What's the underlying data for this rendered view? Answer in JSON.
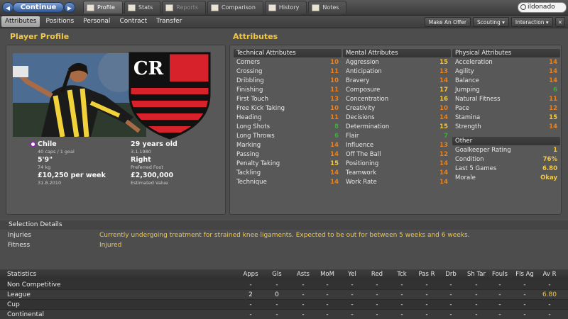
{
  "topbar": {
    "back_glyph": "◀",
    "forward_glyph": "▶",
    "continue_label": "Continue",
    "tabs": [
      {
        "label": "Profile",
        "state": "active"
      },
      {
        "label": "Stats",
        "state": "normal"
      },
      {
        "label": "Reports",
        "state": "dim"
      },
      {
        "label": "Comparison",
        "state": "normal"
      },
      {
        "label": "History",
        "state": "normal"
      },
      {
        "label": "Notes",
        "state": "normal"
      }
    ],
    "search_value": "ildonado"
  },
  "subbar": {
    "tabs": [
      "Attributes",
      "Positions",
      "Personal",
      "Contract",
      "Transfer"
    ],
    "actions": [
      "Make An Offer",
      "Scouting ▾",
      "Interaction ▾"
    ],
    "close_glyph": "✕"
  },
  "player_profile": {
    "title": "Player Profile",
    "nation": "Chile",
    "caps": "40 caps / 1 goal",
    "age": "29 years old",
    "dob": "3.1.1980",
    "height": "5'9\"",
    "weight": "74 kg",
    "foot": "Right",
    "foot_label": "Preferred Foot",
    "wage": "£10,250 per week",
    "contract_end": "31.8.2010",
    "value": "£2,300,000",
    "value_label": "Estimated Value"
  },
  "attributes": {
    "title": "Attributes",
    "technical": {
      "title": "Technical Attributes",
      "items": [
        {
          "name": "Corners",
          "value": 10
        },
        {
          "name": "Crossing",
          "value": 11
        },
        {
          "name": "Dribbling",
          "value": 10
        },
        {
          "name": "Finishing",
          "value": 11
        },
        {
          "name": "First Touch",
          "value": 13
        },
        {
          "name": "Free Kick Taking",
          "value": 10
        },
        {
          "name": "Heading",
          "value": 11
        },
        {
          "name": "Long Shots",
          "value": 8
        },
        {
          "name": "Long Throws",
          "value": 6
        },
        {
          "name": "Marking",
          "value": 14
        },
        {
          "name": "Passing",
          "value": 14
        },
        {
          "name": "Penalty Taking",
          "value": 15
        },
        {
          "name": "Tackling",
          "value": 14
        },
        {
          "name": "Technique",
          "value": 14
        }
      ]
    },
    "mental": {
      "title": "Mental Attributes",
      "items": [
        {
          "name": "Aggression",
          "value": 15
        },
        {
          "name": "Anticipation",
          "value": 13
        },
        {
          "name": "Bravery",
          "value": 14
        },
        {
          "name": "Composure",
          "value": 17
        },
        {
          "name": "Concentration",
          "value": 16
        },
        {
          "name": "Creativity",
          "value": 10
        },
        {
          "name": "Decisions",
          "value": 14
        },
        {
          "name": "Determination",
          "value": 15
        },
        {
          "name": "Flair",
          "value": 7
        },
        {
          "name": "Influence",
          "value": 13
        },
        {
          "name": "Off The Ball",
          "value": 12
        },
        {
          "name": "Positioning",
          "value": 14
        },
        {
          "name": "Teamwork",
          "value": 14
        },
        {
          "name": "Work Rate",
          "value": 14
        }
      ]
    },
    "physical": {
      "title": "Physical Attributes",
      "items": [
        {
          "name": "Acceleration",
          "value": 14
        },
        {
          "name": "Agility",
          "value": 14
        },
        {
          "name": "Balance",
          "value": 14
        },
        {
          "name": "Jumping",
          "value": 6
        },
        {
          "name": "Natural Fitness",
          "value": 11
        },
        {
          "name": "Pace",
          "value": 12
        },
        {
          "name": "Stamina",
          "value": 15
        },
        {
          "name": "Strength",
          "value": 14
        }
      ]
    },
    "other": {
      "title": "Other",
      "items": [
        {
          "name": "Goalkeeper Rating",
          "value": "1"
        },
        {
          "name": "Condition",
          "value": "76%"
        },
        {
          "name": "Last 5 Games",
          "value": "6.80"
        },
        {
          "name": "Morale",
          "value": "Okay"
        }
      ]
    }
  },
  "selection": {
    "title": "Selection Details",
    "injuries_label": "Injuries",
    "injuries_value": "Currently undergoing treatment for strained knee ligaments. Expected to be out for between 5 weeks and 6 weeks.",
    "fitness_label": "Fitness",
    "fitness_value": "Injured"
  },
  "statistics": {
    "title": "Statistics",
    "columns": [
      "Apps",
      "Gls",
      "Asts",
      "MoM",
      "Yel",
      "Red",
      "Tck",
      "Pas R",
      "Drb",
      "Sh Tar",
      "Fouls",
      "Fls Ag",
      "Av R"
    ],
    "rows": [
      {
        "label": "Non Competitive",
        "values": [
          "-",
          "-",
          "-",
          "-",
          "-",
          "-",
          "-",
          "-",
          "-",
          "-",
          "-",
          "-",
          "-"
        ]
      },
      {
        "label": "League",
        "values": [
          "2",
          "0",
          "-",
          "-",
          "-",
          "-",
          "-",
          "-",
          "-",
          "-",
          "-",
          "-",
          "6.80"
        ]
      },
      {
        "label": "Cup",
        "values": [
          "-",
          "-",
          "-",
          "-",
          "-",
          "-",
          "-",
          "-",
          "-",
          "-",
          "-",
          "-",
          "-"
        ]
      },
      {
        "label": "Continental",
        "values": [
          "-",
          "-",
          "-",
          "-",
          "-",
          "-",
          "-",
          "-",
          "-",
          "-",
          "-",
          "-",
          "-"
        ]
      }
    ]
  },
  "colors": {
    "accent_gold": "#f2c744",
    "value_orange": "#e8821e",
    "value_green": "#3cae3c",
    "club_red": "#d8222b",
    "club_black": "#111111"
  },
  "icons": {
    "tabs": "page-icon",
    "search": "search-icon",
    "nation": "nation-flag-icon"
  }
}
